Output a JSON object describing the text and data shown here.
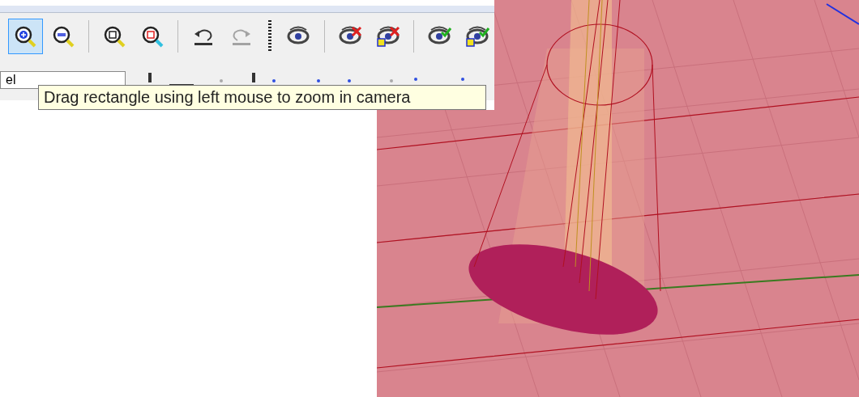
{
  "toolbar": {
    "buttons": [
      {
        "kind": "zoom-in",
        "selected": true,
        "disabled": false
      },
      {
        "kind": "zoom-out",
        "selected": false,
        "disabled": false
      },
      {
        "kind": "sep"
      },
      {
        "kind": "zoom-fit",
        "selected": false,
        "disabled": false
      },
      {
        "kind": "zoom-selected",
        "selected": false,
        "disabled": false
      },
      {
        "kind": "sep"
      },
      {
        "kind": "undo",
        "selected": false,
        "disabled": false
      },
      {
        "kind": "redo",
        "selected": false,
        "disabled": true
      },
      {
        "kind": "grip"
      },
      {
        "kind": "eye",
        "selected": false,
        "disabled": false
      },
      {
        "kind": "sep"
      },
      {
        "kind": "eye-cross",
        "selected": false,
        "disabled": false
      },
      {
        "kind": "eye-cross-box",
        "selected": false,
        "disabled": false
      },
      {
        "kind": "sep"
      },
      {
        "kind": "eye-check",
        "selected": false,
        "disabled": false
      },
      {
        "kind": "eye-check-box",
        "selected": false,
        "disabled": false
      }
    ]
  },
  "field": {
    "value": "el"
  },
  "tooltip": {
    "text": "Drag rectangle using left mouse to zoom in camera"
  }
}
